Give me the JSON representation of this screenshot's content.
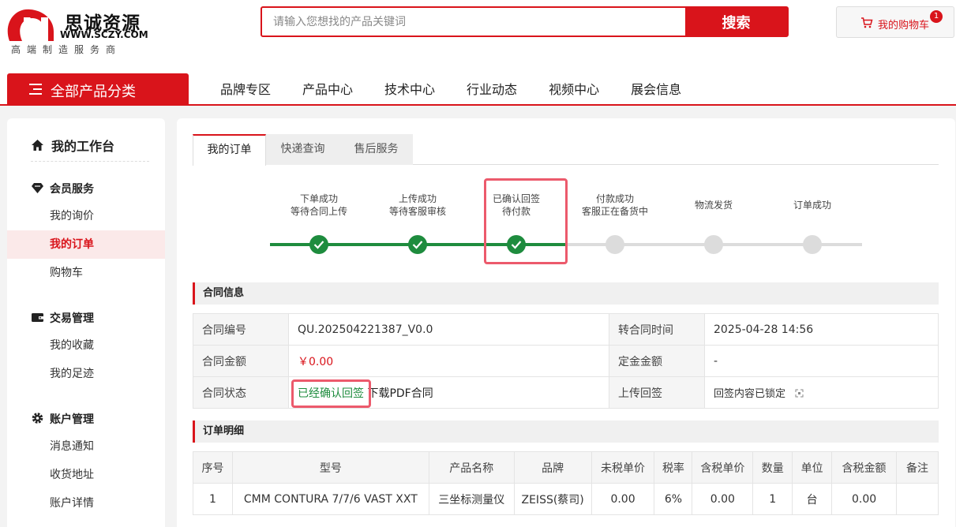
{
  "header": {
    "logo_name": "思诚资源",
    "logo_url": "WWW.SCZY.COM",
    "logo_slogan": "高端制造服务商",
    "search_placeholder": "请输入您想找的产品关键词",
    "search_button": "搜索",
    "cart_label": "我的购物车",
    "cart_count": "1"
  },
  "nav": {
    "all_categories": "全部产品分类",
    "items": [
      "品牌专区",
      "产品中心",
      "技术中心",
      "行业动态",
      "视频中心",
      "展会信息"
    ]
  },
  "sidebar": {
    "workbench": "我的工作台",
    "sections": [
      {
        "title": "会员服务",
        "icon": "diamond-icon",
        "items": [
          "我的询价",
          "我的订单",
          "购物车"
        ]
      },
      {
        "title": "交易管理",
        "icon": "wallet-icon",
        "items": [
          "我的收藏",
          "我的足迹"
        ]
      },
      {
        "title": "账户管理",
        "icon": "gear-icon",
        "items": [
          "消息通知",
          "收货地址",
          "账户详情"
        ]
      }
    ],
    "active_item": "我的订单"
  },
  "tabs": [
    "我的订单",
    "快递查询",
    "售后服务"
  ],
  "steps": [
    {
      "line1": "下单成功",
      "line2": "等待合同上传",
      "done": true
    },
    {
      "line1": "上传成功",
      "line2": "等待客服审核",
      "done": true
    },
    {
      "line1": "已确认回签",
      "line2": "待付款",
      "done": true
    },
    {
      "line1": "付款成功",
      "line2": "客服正在备货中",
      "done": false
    },
    {
      "line1": "物流发货",
      "line2": "",
      "done": false
    },
    {
      "line1": "订单成功",
      "line2": "",
      "done": false
    }
  ],
  "contract": {
    "section_title": "合同信息",
    "no_label": "合同编号",
    "no_value": "QU.202504221387_V0.0",
    "time_label": "转合同时间",
    "time_value": "2025-04-28 14:56",
    "amount_label": "合同金额",
    "amount_value": "￥0.00",
    "deposit_label": "定金金额",
    "deposit_value": "-",
    "status_label": "合同状态",
    "status_value": "已经确认回签",
    "download_link": "下载PDF合同",
    "upload_label": "上传回签",
    "upload_value": "回签内容已锁定"
  },
  "order": {
    "section_title": "订单明细",
    "headers": [
      "序号",
      "型号",
      "产品名称",
      "品牌",
      "未税单价",
      "税率",
      "含税单价",
      "数量",
      "单位",
      "含税金额",
      "备注"
    ],
    "rows": [
      [
        "1",
        "CMM CONTURA 7/7/6 VAST XXT",
        "三坐标测量仪",
        "ZEISS(蔡司)",
        "0.00",
        "6%",
        "0.00",
        "1",
        "台",
        "0.00",
        ""
      ]
    ]
  },
  "colors": {
    "brand_red": "#d9141b",
    "success_green": "#1e8c3e",
    "highlight": "#ec5a6c"
  }
}
